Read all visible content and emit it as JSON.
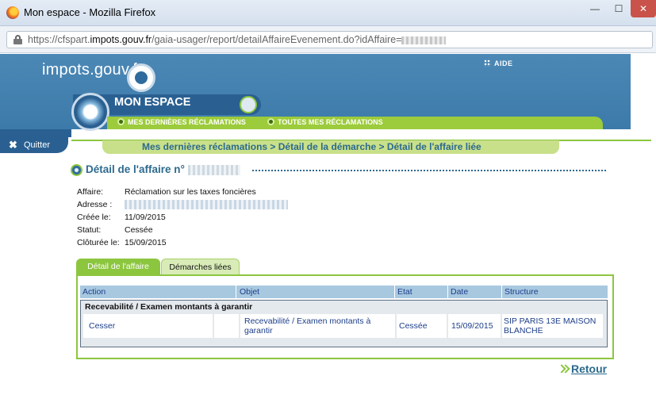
{
  "window": {
    "title": "Mon espace - Mozilla Firefox",
    "minimize": "—",
    "maximize": "☐",
    "close": "✕"
  },
  "urlbar": {
    "prefix": "https://cfspart.",
    "domain": "impots.gouv.fr",
    "path": "/gaia-usager/report/detailAffaireEvenement.do?idAffaire="
  },
  "header": {
    "brand": "impots.gouv.fr",
    "aide": "AIDE",
    "espace_title": "MON ESPACE",
    "nav": [
      {
        "label": "MES DERNIÈRES RÉCLAMATIONS"
      },
      {
        "label": "TOUTES MES RÉCLAMATIONS"
      }
    ],
    "quitter": "Quitter",
    "quitter_icon": "✖"
  },
  "breadcrumb": "Mes dernières réclamations > Détail de la démarche > Détail de l'affaire liée",
  "section": {
    "title": "Détail de l'affaire n°"
  },
  "details": [
    {
      "label": "Affaire:",
      "value": "Réclamation sur les taxes foncières"
    },
    {
      "label": "Adresse :",
      "value": ""
    },
    {
      "label": "Créée le:",
      "value": "11/09/2015"
    },
    {
      "label": "Statut:",
      "value": "Cessée"
    },
    {
      "label": "Clôturée le:",
      "value": "15/09/2015"
    }
  ],
  "tabs": [
    {
      "label": "Détail de l'affaire",
      "active": true
    },
    {
      "label": "Démarches liées",
      "active": false
    }
  ],
  "table": {
    "headers": [
      "Action",
      "Objet",
      "Etat",
      "Date",
      "Structure"
    ],
    "group_label": "Recevabilité / Examen montants à garantir",
    "rows": [
      {
        "action": "Cesser",
        "objet_line1": "Recevabilité / Examen montants à",
        "objet_line2": "garantir",
        "etat": "Cessée",
        "date": "15/09/2015",
        "structure_line1": "SIP PARIS 13E MAISON",
        "structure_line2": "BLANCHE"
      }
    ]
  },
  "retour": "Retour",
  "colors": {
    "brand_blue": "#3c7aa9",
    "dark_blue": "#2a6091",
    "green": "#8cc63f",
    "text_blue": "#2d6a8e"
  }
}
